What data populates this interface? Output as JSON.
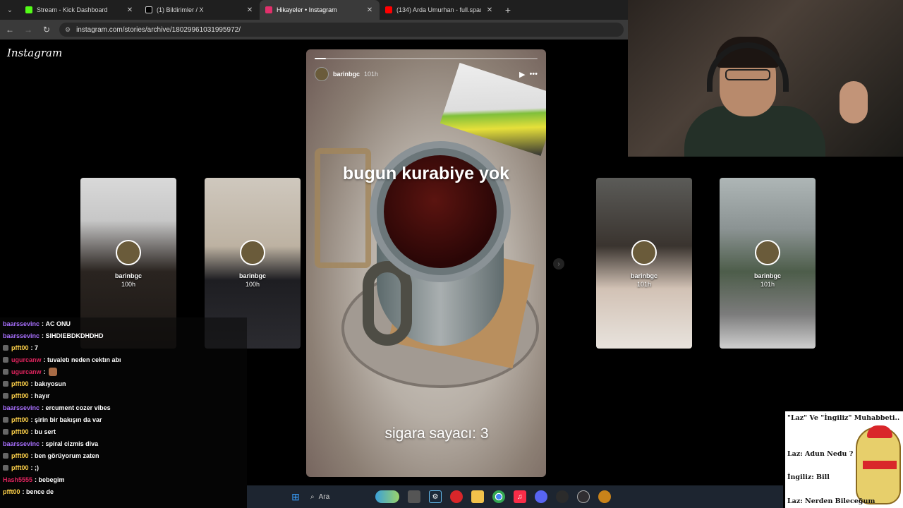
{
  "browser": {
    "tabs": [
      {
        "label": "Stream - Kick Dashboard",
        "favicon_color": "#53fc18",
        "active": false
      },
      {
        "label": "(1) Bildirimler / X",
        "favicon_color": "#000000",
        "active": false
      },
      {
        "label": "Hikayeler • Instagram",
        "favicon_color": "#e1306c",
        "active": true
      },
      {
        "label": "(134) Arda Umurhan - full.space",
        "favicon_color": "#ff0000",
        "active": false
      }
    ],
    "url": "instagram.com/stories/archive/18029961031995972/"
  },
  "instagram": {
    "logo": "Instagram",
    "main_story": {
      "username": "barinbgc",
      "time": "101h",
      "progress": 0.05,
      "text_top": "bugun kurabiye yok",
      "text_bottom": "sigara sayacı: 3"
    },
    "thumbs": [
      {
        "username": "barinbgc",
        "time": "100h"
      },
      {
        "username": "barinbgc",
        "time": "100h"
      },
      {
        "username": "barinbgc",
        "time": "101h"
      },
      {
        "username": "barinbgc",
        "time": "101h"
      }
    ]
  },
  "chat": {
    "messages": [
      {
        "user": "baarssevinc",
        "color": "#a970ff",
        "text": "AC ONU"
      },
      {
        "user": "baarssevinc",
        "color": "#a970ff",
        "text": "SIHDIEBDKDHDHD"
      },
      {
        "user": "pfft00",
        "color": "#ffd24a",
        "text": "7"
      },
      {
        "user": "ugurcanw",
        "color": "#e0245e",
        "text": "tuvaletı neden cektın abı"
      },
      {
        "user": "ugurcanw",
        "color": "#e0245e",
        "text": ""
      },
      {
        "user": "pfft00",
        "color": "#ffd24a",
        "text": "bakıyosun"
      },
      {
        "user": "pfft00",
        "color": "#ffd24a",
        "text": "hayır"
      },
      {
        "user": "baarssevinc",
        "color": "#a970ff",
        "text": "ercument cozer vibes"
      },
      {
        "user": "pfft00",
        "color": "#ffd24a",
        "text": "şirin bir bakışın da var"
      },
      {
        "user": "pfft00",
        "color": "#ffd24a",
        "text": "bu sert"
      },
      {
        "user": "baarssevinc",
        "color": "#a970ff",
        "text": "spiral cizmis diva"
      },
      {
        "user": "pfft00",
        "color": "#ffd24a",
        "text": "ben görüyorum zaten"
      },
      {
        "user": "pfft00",
        "color": "#ffd24a",
        "text": ";)"
      },
      {
        "user": "Hash5555",
        "color": "#e0245e",
        "text": "bebegim"
      },
      {
        "user": "pfft00",
        "color": "#ffd24a",
        "text": "bence de"
      }
    ]
  },
  "meme": {
    "line1": "\"Laz\" Ve \"İngiliz\" Muhabbeti..",
    "line2": "Laz: Adun Nedu ?",
    "line3": "İngiliz: Bill",
    "line4": "Laz: Nerden Bileceğum"
  },
  "taskbar": {
    "search_label": "Ara"
  }
}
